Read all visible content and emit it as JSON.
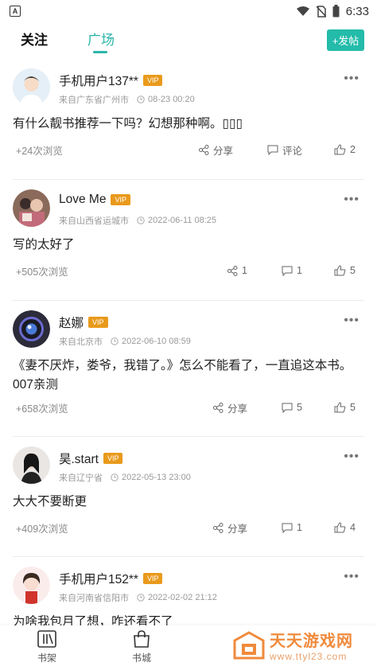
{
  "status": {
    "time": "6:33",
    "left_icon": "A"
  },
  "tabs": {
    "follow": "关注",
    "square": "广场",
    "post_button": "+发帖"
  },
  "posts": [
    {
      "username": "手机用户137**",
      "vip": "VIP",
      "location": "来自广东省广州市",
      "time": "08-23 00:20",
      "content": "有什么靓书推荐一下吗？幻想那种啊。▯▯▯",
      "views": "+24次浏览",
      "share": "分享",
      "comment": "评论",
      "likes": "2"
    },
    {
      "username": "Love Me",
      "vip": "VIP",
      "location": "来自山西省运城市",
      "time": "2022-06-11 08:25",
      "content": "写的太好了",
      "views": "+505次浏览",
      "share": "1",
      "comment": "1",
      "likes": "5"
    },
    {
      "username": "赵娜",
      "vip": "VIP",
      "location": "来自北京市",
      "time": "2022-06-10 08:59",
      "content": "《妻不厌炸，娄爷，我错了。》怎么不能看了，一直追这本书。007亲测",
      "views": "+658次浏览",
      "share": "分享",
      "comment": "5",
      "likes": "5"
    },
    {
      "username": "昊.start",
      "vip": "VIP",
      "location": "来自辽宁省",
      "time": "2022-05-13 23:00",
      "content": "大大不要断更",
      "views": "+409次浏览",
      "share": "分享",
      "comment": "1",
      "likes": "4"
    },
    {
      "username": "手机用户152**",
      "vip": "VIP",
      "location": "来自河南省信阳市",
      "time": "2022-02-02 21:12",
      "content": "为啥我包月了想，咋还看不了",
      "views": "",
      "share": "",
      "comment": "",
      "likes": ""
    }
  ],
  "bottom_nav": {
    "bookshelf": "书架",
    "bookstore": "书城"
  },
  "watermark": {
    "title": "天天游戏网",
    "url": "www.ttyl23.com"
  }
}
